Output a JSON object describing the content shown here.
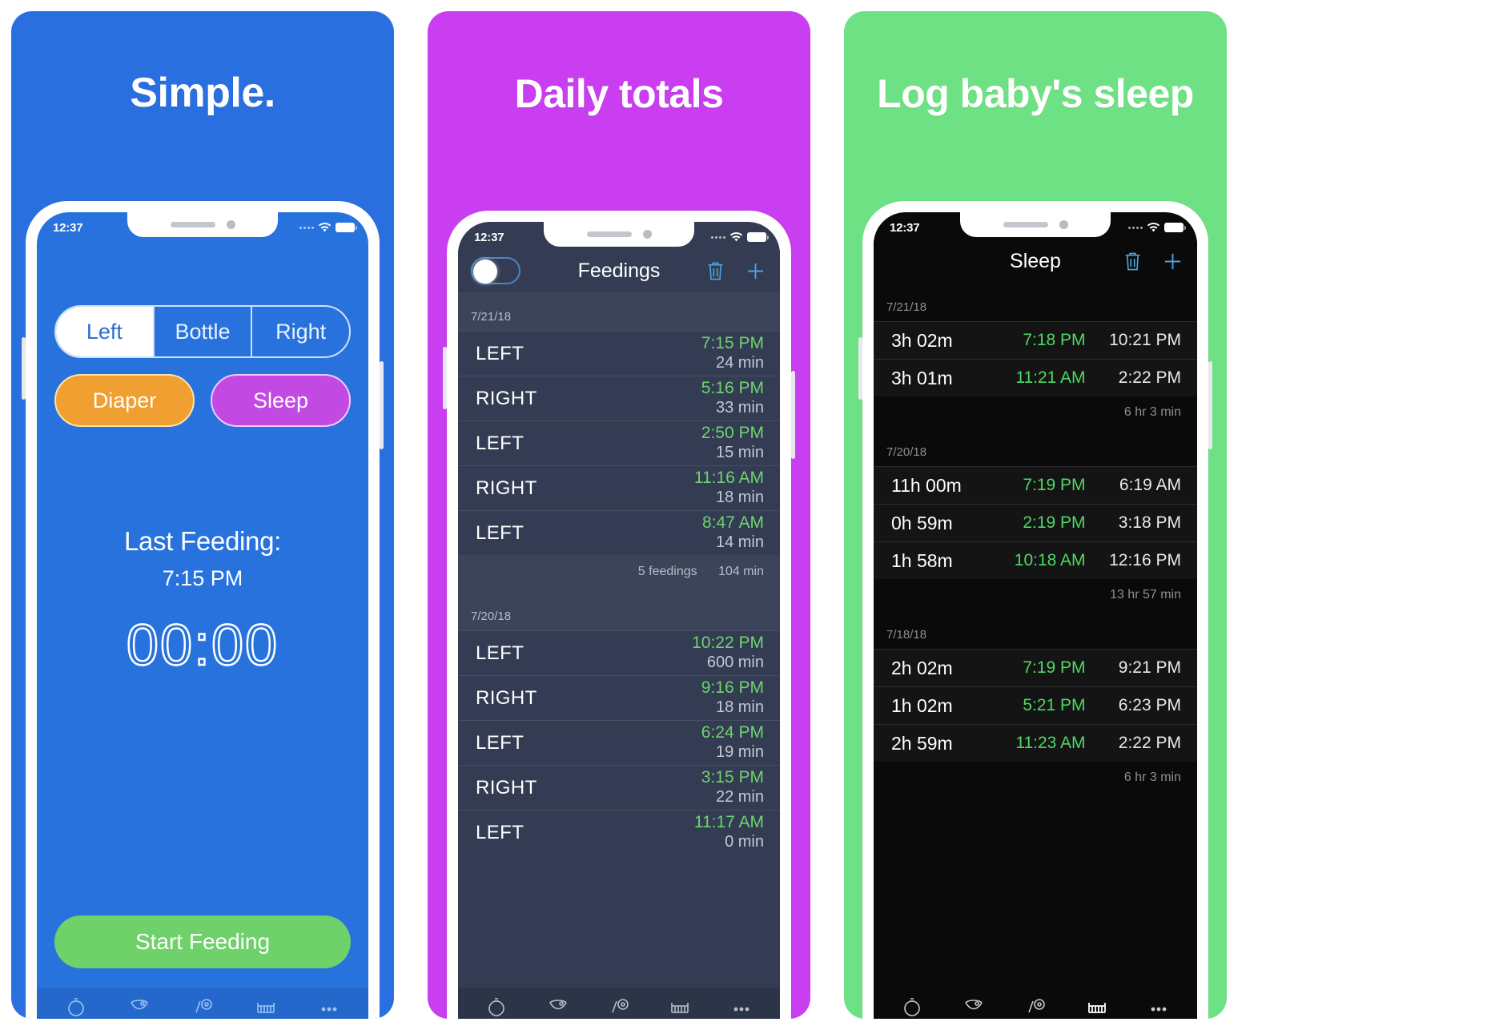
{
  "panels": [
    {
      "title": "Simple.",
      "bg": "#2a6fdf",
      "status": {
        "time": "12:37"
      },
      "segments": [
        {
          "label": "Left",
          "active": true
        },
        {
          "label": "Bottle",
          "active": false
        },
        {
          "label": "Right",
          "active": false
        }
      ],
      "pills": [
        {
          "label": "Diaper",
          "color": "#f0a030"
        },
        {
          "label": "Sleep",
          "color": "#c24ae2"
        }
      ],
      "last_feeding_label": "Last Feeding:",
      "last_feeding_time": "7:15 PM",
      "timer": "00:00",
      "start_button": "Start Feeding"
    },
    {
      "title": "Daily totals",
      "bg": "#c93ef0",
      "status": {
        "time": "12:37"
      },
      "nav_title": "Feedings",
      "sections": [
        {
          "date": "7/21/18",
          "rows": [
            {
              "side": "LEFT",
              "time": "7:15 PM",
              "duration": "24 min"
            },
            {
              "side": "RIGHT",
              "time": "5:16 PM",
              "duration": "33 min"
            },
            {
              "side": "LEFT",
              "time": "2:50 PM",
              "duration": "15 min"
            },
            {
              "side": "RIGHT",
              "time": "11:16 AM",
              "duration": "18 min"
            },
            {
              "side": "LEFT",
              "time": "8:47 AM",
              "duration": "14 min"
            }
          ],
          "summary_count": "5 feedings",
          "summary_total": "104 min"
        },
        {
          "date": "7/20/18",
          "rows": [
            {
              "side": "LEFT",
              "time": "10:22 PM",
              "duration": "600 min"
            },
            {
              "side": "RIGHT",
              "time": "9:16 PM",
              "duration": "18 min"
            },
            {
              "side": "LEFT",
              "time": "6:24 PM",
              "duration": "19 min"
            },
            {
              "side": "RIGHT",
              "time": "3:15 PM",
              "duration": "22 min"
            },
            {
              "side": "LEFT",
              "time": "11:17 AM",
              "duration": "0 min"
            }
          ],
          "summary_count": "",
          "summary_total": ""
        }
      ]
    },
    {
      "title": "Log baby's sleep",
      "bg": "#6ee184",
      "status": {
        "time": "12:37"
      },
      "nav_title": "Sleep",
      "sections": [
        {
          "date": "7/21/18",
          "rows": [
            {
              "duration": "3h 02m",
              "start": "7:18 PM",
              "end": "10:21 PM"
            },
            {
              "duration": "3h 01m",
              "start": "11:21 AM",
              "end": "2:22 PM"
            }
          ],
          "summary": "6 hr 3 min"
        },
        {
          "date": "7/20/18",
          "rows": [
            {
              "duration": "11h 00m",
              "start": "7:19 PM",
              "end": "6:19 AM"
            },
            {
              "duration": "0h 59m",
              "start": "2:19 PM",
              "end": "3:18 PM"
            },
            {
              "duration": "1h 58m",
              "start": "10:18 AM",
              "end": "12:16 PM"
            }
          ],
          "summary": "13 hr 57 min"
        },
        {
          "date": "7/18/18",
          "rows": [
            {
              "duration": "2h 02m",
              "start": "7:19 PM",
              "end": "9:21 PM"
            },
            {
              "duration": "1h 02m",
              "start": "5:21 PM",
              "end": "6:23 PM"
            },
            {
              "duration": "2h 59m",
              "start": "11:23 AM",
              "end": "2:22 PM"
            }
          ],
          "summary": "6 hr 3 min"
        }
      ]
    }
  ],
  "icons": {
    "trash": "trash-icon",
    "plus": "plus-icon",
    "wifi": "wifi-icon",
    "battery": "battery-icon",
    "toggle": "toggle-switch",
    "tabs": [
      "bottle-icon",
      "diaper-icon",
      "pumping-icon",
      "crib-icon",
      "more-icon"
    ]
  },
  "colors": {
    "panel1_bg": "#2a6fdf",
    "panel2_bg": "#c93ef0",
    "panel3_bg": "#6ee184",
    "accent_green": "#6fd36f",
    "sleep_green": "#4cd964",
    "orange": "#f0a030",
    "purple": "#c24ae2",
    "start_green": "#6ed169"
  }
}
